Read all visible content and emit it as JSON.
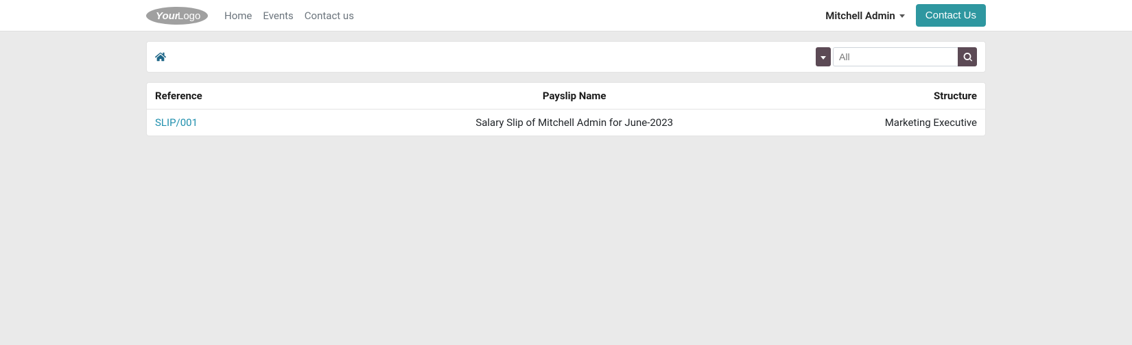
{
  "nav": {
    "logo_main": "Your",
    "logo_sub": "Logo",
    "links": [
      "Home",
      "Events",
      "Contact us"
    ],
    "user": "Mitchell Admin",
    "contact_btn": "Contact Us"
  },
  "search": {
    "placeholder": "All"
  },
  "table": {
    "headers": {
      "reference": "Reference",
      "payslip_name": "Payslip Name",
      "structure": "Structure"
    },
    "rows": [
      {
        "reference": "SLIP/001",
        "payslip_name": "Salary Slip of Mitchell Admin for June-2023",
        "structure": "Marketing Executive"
      }
    ]
  }
}
